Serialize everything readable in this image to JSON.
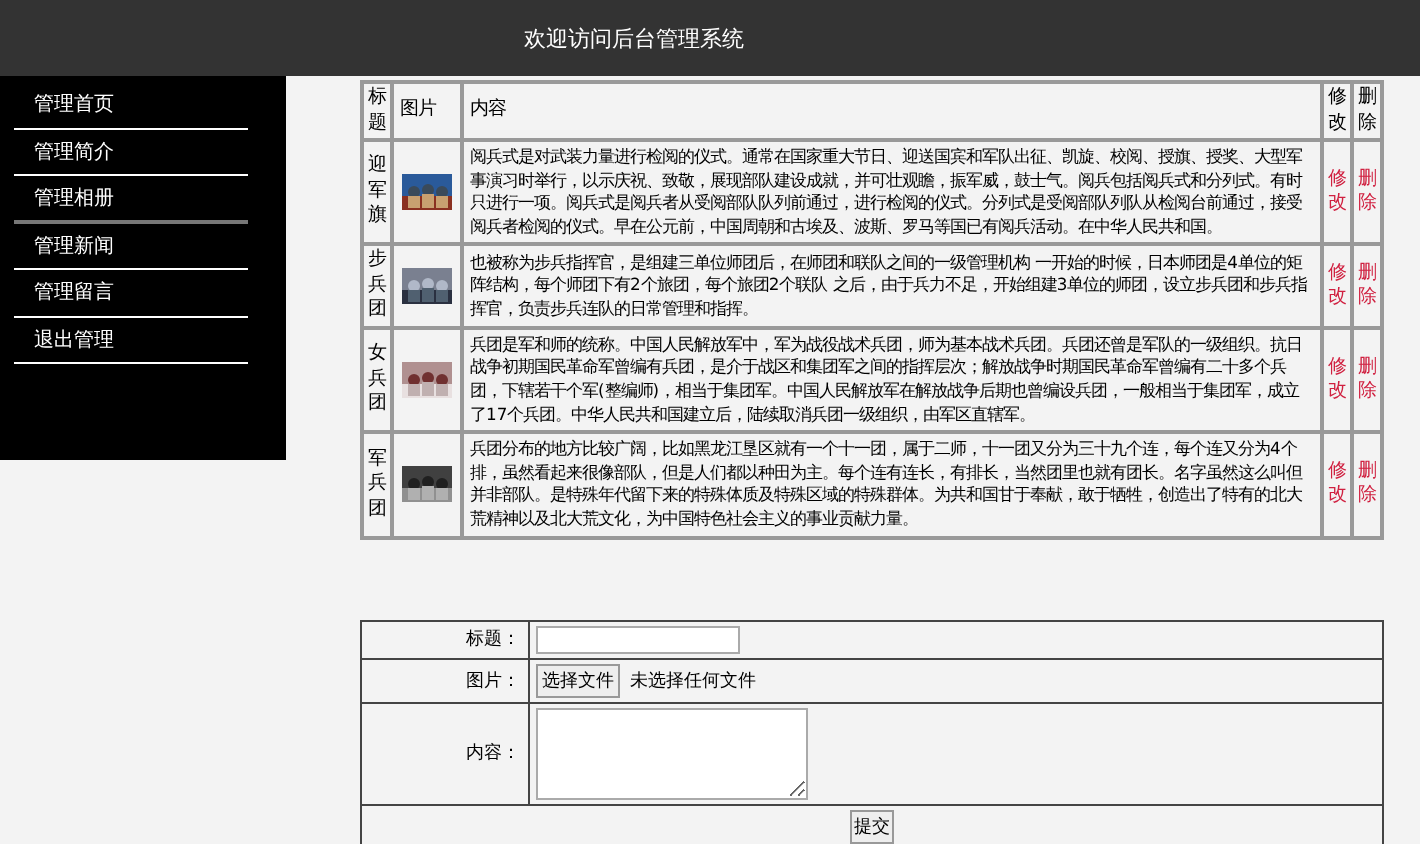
{
  "header": {
    "title": "欢迎访问后台管理系统"
  },
  "sidebar": {
    "items": [
      {
        "label": "管理首页",
        "selected": false
      },
      {
        "label": "管理简介",
        "selected": false
      },
      {
        "label": "管理相册",
        "selected": true
      },
      {
        "label": "管理新闻",
        "selected": false
      },
      {
        "label": "管理留言",
        "selected": false
      },
      {
        "label": "退出管理",
        "selected": false
      }
    ]
  },
  "table": {
    "columns": [
      "标题",
      "图片",
      "内容",
      "修改",
      "删除"
    ],
    "rows": [
      {
        "title": "迎军旗",
        "content": "阅兵式是对武装力量进行检阅的仪式。通常在国家重大节日、迎送国宾和军队出征、凯旋、校阅、授旗、授奖、大型军事演习时举行，以示庆祝、致敬，展现部队建设成就，并可壮观瞻，振军威，鼓士气。阅兵包括阅兵式和分列式。有时只进行一项。阅兵式是阅兵者从受阅部队队列前通过，进行检阅的仪式。分列式是受阅部队列队从检阅台前通过，接受阅兵者检阅的仪式。早在公元前，中国周朝和古埃及、波斯、罗马等国已有阅兵活动。在中华人民共和国。",
        "edit": "修改",
        "delete": "删除"
      },
      {
        "title": "步兵团",
        "content": "也被称为步兵指挥官，是组建三单位师团后，在师团和联队之间的一级管理机构 一开始的时候，日本师团是4单位的矩阵结构，每个师团下有2个旅团，每个旅团2个联队 之后，由于兵力不足，开始组建3单位的师团，设立步兵团和步兵指挥官，负责步兵连队的日常管理和指挥。",
        "edit": "修改",
        "delete": "删除"
      },
      {
        "title": "女兵团",
        "content": "兵团是军和师的统称。中国人民解放军中，军为战役战术兵团，师为基本战术兵团。兵团还曾是军队的一级组织。抗日战争初期国民革命军曾编有兵团，是介于战区和集团军之间的指挥层次；解放战争时期国民革命军曾编有二十多个兵团，下辖若干个军(整编师)，相当于集团军。中国人民解放军在解放战争后期也曾编设兵团，一般相当于集团军，成立了17个兵团。中华人民共和国建立后，陆续取消兵团一级组织，由军区直辖军。",
        "edit": "修改",
        "delete": "删除"
      },
      {
        "title": "军兵团",
        "content": "兵团分布的地方比较广阔，比如黑龙江垦区就有一个十一团，属于二师，十一团又分为三十九个连，每个连又分为4个排，虽然看起来很像部队，但是人们都以种田为主。每个连有连长，有排长，当然团里也就有团长。名字虽然这么叫但并非部队。是特殊年代留下来的特殊体质及特殊区域的特殊群体。为共和国甘于奉献，敢于牺牲，创造出了特有的北大荒精神以及北大荒文化，为中国特色社会主义的事业贡献力量。",
        "edit": "修改",
        "delete": "删除"
      }
    ]
  },
  "form": {
    "title_label": "标题：",
    "picture_label": "图片：",
    "file_button": "选择文件",
    "file_status": "未选择任何文件",
    "content_label": "内容：",
    "submit": "提交"
  }
}
